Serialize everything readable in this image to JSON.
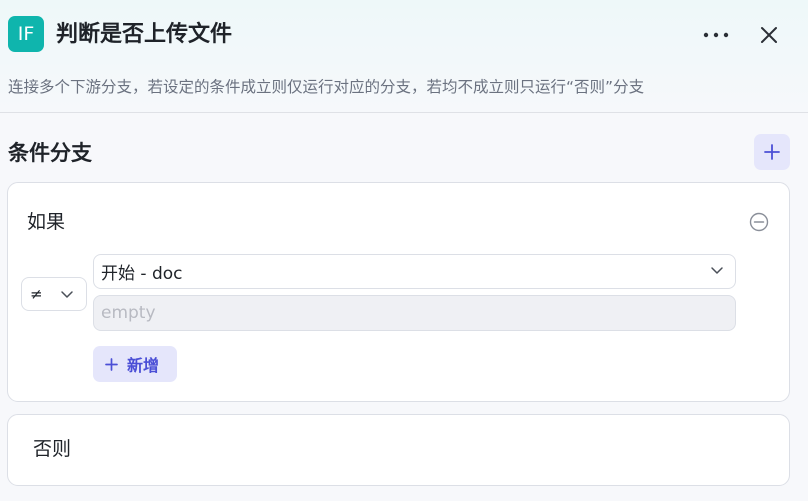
{
  "header": {
    "logo_text": "IF",
    "title": "判断是否上传文件",
    "description": "连接多个下游分支，若设定的条件成立则仅运行对应的分支，若均不成立则只运行“否则”分支"
  },
  "section": {
    "title": "条件分支"
  },
  "if_card": {
    "label": "如果",
    "condition": {
      "operator": "≠",
      "variable": "开始 - doc",
      "value": "",
      "value_placeholder": "empty"
    },
    "add_label": "新增"
  },
  "else_card": {
    "label": "否则"
  },
  "colors": {
    "logo_bg": "#0fb5ad",
    "accent": "#4b4fd6",
    "accent_bg": "#e5e6fb"
  },
  "icons": {
    "more": "more-horizontal-icon",
    "close": "close-icon",
    "add_branch": "plus-icon",
    "remove": "minus-circle-icon",
    "chevron": "chevron-down-icon"
  }
}
